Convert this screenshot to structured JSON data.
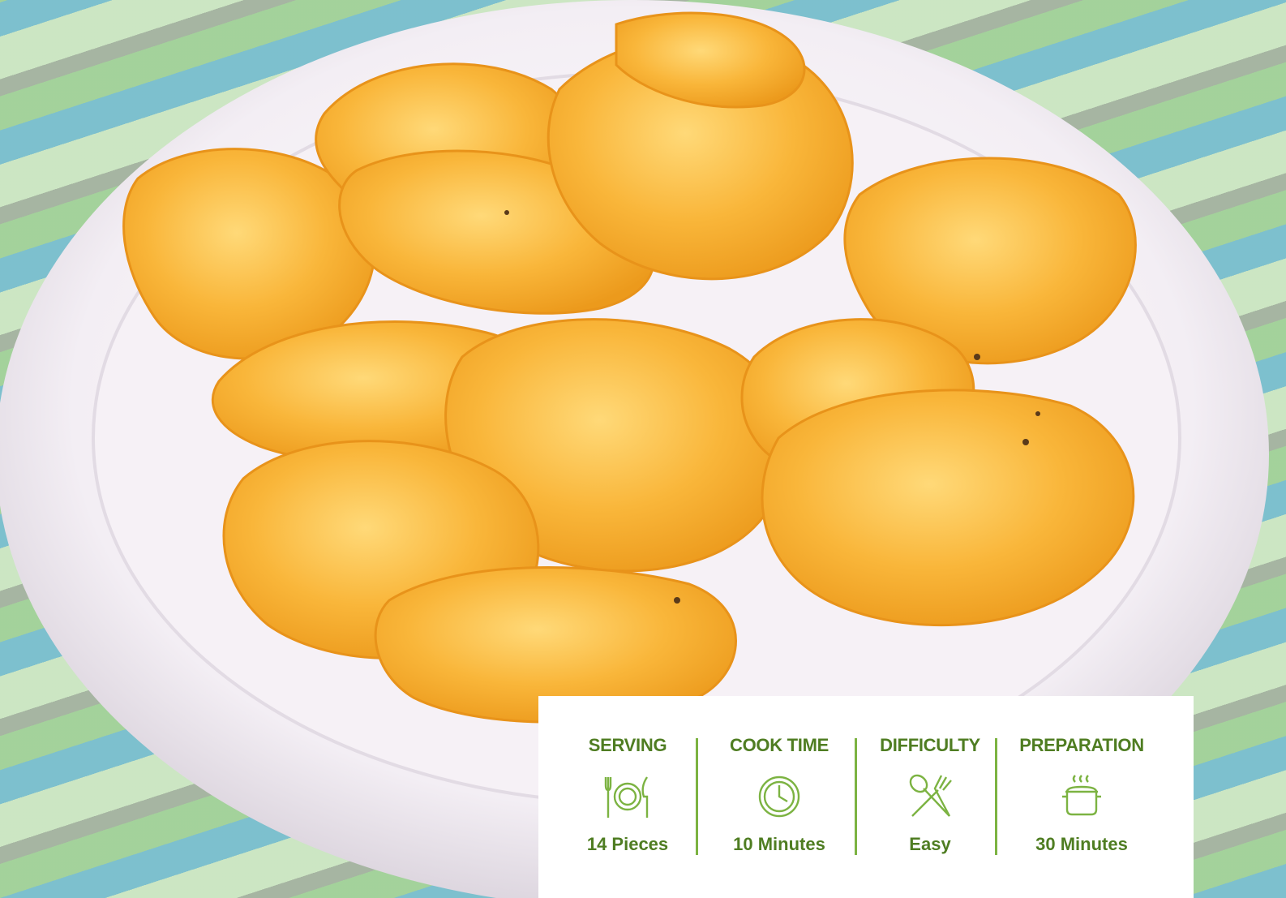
{
  "colors": {
    "accent_green": "#7cb342",
    "text_green": "#4f7d22",
    "card_bg": "#ffffff"
  },
  "info_card": {
    "items": [
      {
        "label": "SERVING",
        "value": "14 Pieces",
        "icon": "plate-fork-knife-icon"
      },
      {
        "label": "COOK TIME",
        "value": "10 Minutes",
        "icon": "clock-icon"
      },
      {
        "label": "DIFFICULTY",
        "value": "Easy",
        "icon": "spoon-fork-icon"
      },
      {
        "label": "PREPARATION",
        "value": "30 Minutes",
        "icon": "cooking-pot-icon"
      }
    ]
  }
}
